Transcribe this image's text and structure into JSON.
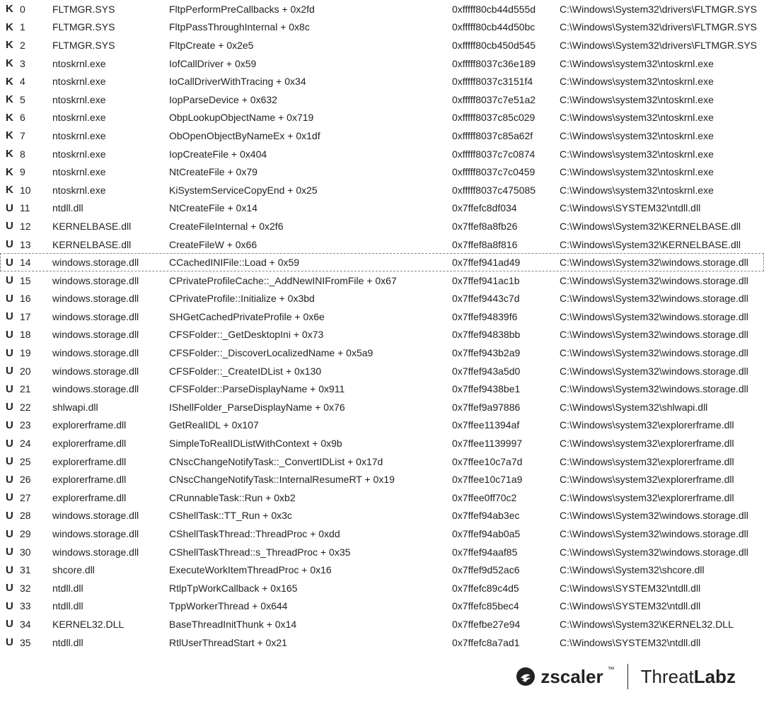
{
  "selected_index": 14,
  "stack": [
    {
      "mode": "K",
      "idx": "0",
      "module": "FLTMGR.SYS",
      "func": "FltpPerformPreCallbacks + 0x2fd",
      "addr": "0xfffff80cb44d555d",
      "path": "C:\\Windows\\System32\\drivers\\FLTMGR.SYS"
    },
    {
      "mode": "K",
      "idx": "1",
      "module": "FLTMGR.SYS",
      "func": "FltpPassThroughInternal + 0x8c",
      "addr": "0xfffff80cb44d50bc",
      "path": "C:\\Windows\\System32\\drivers\\FLTMGR.SYS"
    },
    {
      "mode": "K",
      "idx": "2",
      "module": "FLTMGR.SYS",
      "func": "FltpCreate + 0x2e5",
      "addr": "0xfffff80cb450d545",
      "path": "C:\\Windows\\System32\\drivers\\FLTMGR.SYS"
    },
    {
      "mode": "K",
      "idx": "3",
      "module": "ntoskrnl.exe",
      "func": "IofCallDriver + 0x59",
      "addr": "0xfffff8037c36e189",
      "path": "C:\\Windows\\system32\\ntoskrnl.exe"
    },
    {
      "mode": "K",
      "idx": "4",
      "module": "ntoskrnl.exe",
      "func": "IoCallDriverWithTracing + 0x34",
      "addr": "0xfffff8037c3151f4",
      "path": "C:\\Windows\\system32\\ntoskrnl.exe"
    },
    {
      "mode": "K",
      "idx": "5",
      "module": "ntoskrnl.exe",
      "func": "IopParseDevice + 0x632",
      "addr": "0xfffff8037c7e51a2",
      "path": "C:\\Windows\\system32\\ntoskrnl.exe"
    },
    {
      "mode": "K",
      "idx": "6",
      "module": "ntoskrnl.exe",
      "func": "ObpLookupObjectName + 0x719",
      "addr": "0xfffff8037c85c029",
      "path": "C:\\Windows\\system32\\ntoskrnl.exe"
    },
    {
      "mode": "K",
      "idx": "7",
      "module": "ntoskrnl.exe",
      "func": "ObOpenObjectByNameEx + 0x1df",
      "addr": "0xfffff8037c85a62f",
      "path": "C:\\Windows\\system32\\ntoskrnl.exe"
    },
    {
      "mode": "K",
      "idx": "8",
      "module": "ntoskrnl.exe",
      "func": "IopCreateFile + 0x404",
      "addr": "0xfffff8037c7c0874",
      "path": "C:\\Windows\\system32\\ntoskrnl.exe"
    },
    {
      "mode": "K",
      "idx": "9",
      "module": "ntoskrnl.exe",
      "func": "NtCreateFile + 0x79",
      "addr": "0xfffff8037c7c0459",
      "path": "C:\\Windows\\system32\\ntoskrnl.exe"
    },
    {
      "mode": "K",
      "idx": "10",
      "module": "ntoskrnl.exe",
      "func": "KiSystemServiceCopyEnd + 0x25",
      "addr": "0xfffff8037c475085",
      "path": "C:\\Windows\\system32\\ntoskrnl.exe"
    },
    {
      "mode": "U",
      "idx": "11",
      "module": "ntdll.dll",
      "func": "NtCreateFile + 0x14",
      "addr": "0x7ffefc8df034",
      "path": "C:\\Windows\\SYSTEM32\\ntdll.dll"
    },
    {
      "mode": "U",
      "idx": "12",
      "module": "KERNELBASE.dll",
      "func": "CreateFileInternal + 0x2f6",
      "addr": "0x7ffef8a8fb26",
      "path": "C:\\Windows\\System32\\KERNELBASE.dll"
    },
    {
      "mode": "U",
      "idx": "13",
      "module": "KERNELBASE.dll",
      "func": "CreateFileW + 0x66",
      "addr": "0x7ffef8a8f816",
      "path": "C:\\Windows\\System32\\KERNELBASE.dll"
    },
    {
      "mode": "U",
      "idx": "14",
      "module": "windows.storage.dll",
      "func": "CCachedINIFile::Load + 0x59",
      "addr": "0x7ffef941ad49",
      "path": "C:\\Windows\\System32\\windows.storage.dll"
    },
    {
      "mode": "U",
      "idx": "15",
      "module": "windows.storage.dll",
      "func": "CPrivateProfileCache::_AddNewINIFromFile + 0x67",
      "addr": "0x7ffef941ac1b",
      "path": "C:\\Windows\\System32\\windows.storage.dll"
    },
    {
      "mode": "U",
      "idx": "16",
      "module": "windows.storage.dll",
      "func": "CPrivateProfile::Initialize + 0x3bd",
      "addr": "0x7ffef9443c7d",
      "path": "C:\\Windows\\System32\\windows.storage.dll"
    },
    {
      "mode": "U",
      "idx": "17",
      "module": "windows.storage.dll",
      "func": "SHGetCachedPrivateProfile + 0x6e",
      "addr": "0x7ffef94839f6",
      "path": "C:\\Windows\\System32\\windows.storage.dll"
    },
    {
      "mode": "U",
      "idx": "18",
      "module": "windows.storage.dll",
      "func": "CFSFolder::_GetDesktopIni + 0x73",
      "addr": "0x7ffef94838bb",
      "path": "C:\\Windows\\System32\\windows.storage.dll"
    },
    {
      "mode": "U",
      "idx": "19",
      "module": "windows.storage.dll",
      "func": "CFSFolder::_DiscoverLocalizedName + 0x5a9",
      "addr": "0x7ffef943b2a9",
      "path": "C:\\Windows\\System32\\windows.storage.dll"
    },
    {
      "mode": "U",
      "idx": "20",
      "module": "windows.storage.dll",
      "func": "CFSFolder::_CreateIDList + 0x130",
      "addr": "0x7ffef943a5d0",
      "path": "C:\\Windows\\System32\\windows.storage.dll"
    },
    {
      "mode": "U",
      "idx": "21",
      "module": "windows.storage.dll",
      "func": "CFSFolder::ParseDisplayName + 0x911",
      "addr": "0x7ffef9438be1",
      "path": "C:\\Windows\\System32\\windows.storage.dll"
    },
    {
      "mode": "U",
      "idx": "22",
      "module": "shlwapi.dll",
      "func": "IShellFolder_ParseDisplayName + 0x76",
      "addr": "0x7ffef9a97886",
      "path": "C:\\Windows\\System32\\shlwapi.dll"
    },
    {
      "mode": "U",
      "idx": "23",
      "module": "explorerframe.dll",
      "func": "GetRealIDL + 0x107",
      "addr": "0x7ffee11394af",
      "path": "C:\\Windows\\system32\\explorerframe.dll"
    },
    {
      "mode": "U",
      "idx": "24",
      "module": "explorerframe.dll",
      "func": "SimpleToRealIDListWithContext + 0x9b",
      "addr": "0x7ffee1139997",
      "path": "C:\\Windows\\system32\\explorerframe.dll"
    },
    {
      "mode": "U",
      "idx": "25",
      "module": "explorerframe.dll",
      "func": "CNscChangeNotifyTask::_ConvertIDList + 0x17d",
      "addr": "0x7ffee10c7a7d",
      "path": "C:\\Windows\\system32\\explorerframe.dll"
    },
    {
      "mode": "U",
      "idx": "26",
      "module": "explorerframe.dll",
      "func": "CNscChangeNotifyTask::InternalResumeRT + 0x19",
      "addr": "0x7ffee10c71a9",
      "path": "C:\\Windows\\system32\\explorerframe.dll"
    },
    {
      "mode": "U",
      "idx": "27",
      "module": "explorerframe.dll",
      "func": "CRunnableTask::Run + 0xb2",
      "addr": "0x7ffee0ff70c2",
      "path": "C:\\Windows\\system32\\explorerframe.dll"
    },
    {
      "mode": "U",
      "idx": "28",
      "module": "windows.storage.dll",
      "func": "CShellTask::TT_Run + 0x3c",
      "addr": "0x7ffef94ab3ec",
      "path": "C:\\Windows\\System32\\windows.storage.dll"
    },
    {
      "mode": "U",
      "idx": "29",
      "module": "windows.storage.dll",
      "func": "CShellTaskThread::ThreadProc + 0xdd",
      "addr": "0x7ffef94ab0a5",
      "path": "C:\\Windows\\System32\\windows.storage.dll"
    },
    {
      "mode": "U",
      "idx": "30",
      "module": "windows.storage.dll",
      "func": "CShellTaskThread::s_ThreadProc + 0x35",
      "addr": "0x7ffef94aaf85",
      "path": "C:\\Windows\\System32\\windows.storage.dll"
    },
    {
      "mode": "U",
      "idx": "31",
      "module": "shcore.dll",
      "func": "ExecuteWorkItemThreadProc + 0x16",
      "addr": "0x7ffef9d52ac6",
      "path": "C:\\Windows\\System32\\shcore.dll"
    },
    {
      "mode": "U",
      "idx": "32",
      "module": "ntdll.dll",
      "func": "RtlpTpWorkCallback + 0x165",
      "addr": "0x7ffefc89c4d5",
      "path": "C:\\Windows\\SYSTEM32\\ntdll.dll"
    },
    {
      "mode": "U",
      "idx": "33",
      "module": "ntdll.dll",
      "func": "TppWorkerThread + 0x644",
      "addr": "0x7ffefc85bec4",
      "path": "C:\\Windows\\SYSTEM32\\ntdll.dll"
    },
    {
      "mode": "U",
      "idx": "34",
      "module": "KERNEL32.DLL",
      "func": "BaseThreadInitThunk + 0x14",
      "addr": "0x7ffefbe27e94",
      "path": "C:\\Windows\\System32\\KERNEL32.DLL"
    },
    {
      "mode": "U",
      "idx": "35",
      "module": "ntdll.dll",
      "func": "RtlUserThreadStart + 0x21",
      "addr": "0x7ffefc8a7ad1",
      "path": "C:\\Windows\\SYSTEM32\\ntdll.dll"
    }
  ],
  "footer": {
    "brand": "zscaler",
    "tm": "™",
    "lab_pre": "Threat",
    "lab_bold": "Labz"
  }
}
